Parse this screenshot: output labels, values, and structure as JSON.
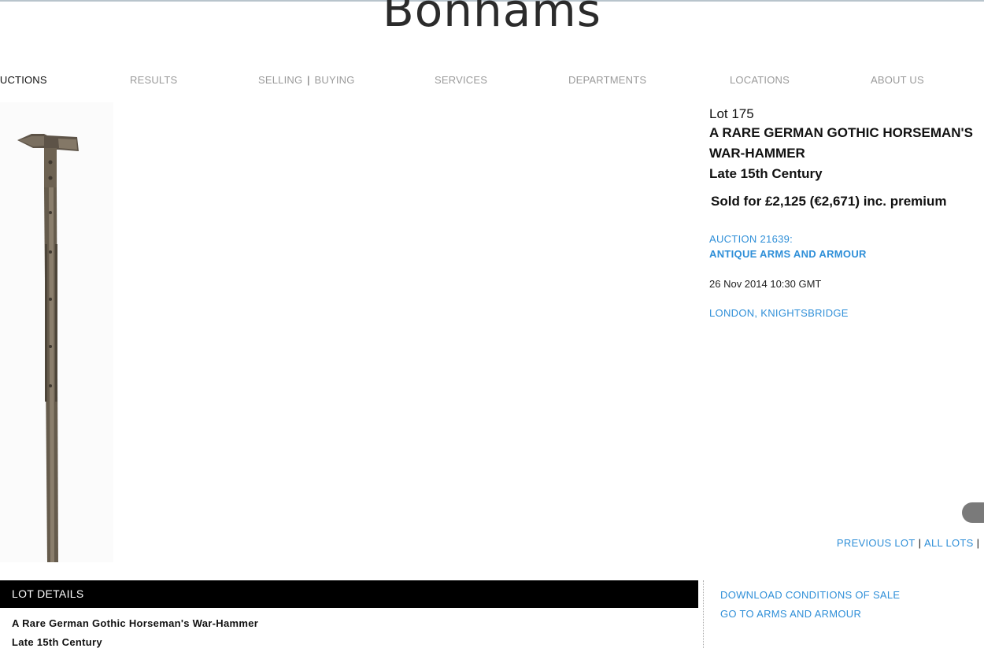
{
  "site": {
    "logo": "Bonhams"
  },
  "nav": {
    "auctions": "AUCTIONS",
    "results": "RESULTS",
    "selling": "SELLING",
    "separator": "|",
    "buying": "BUYING",
    "services": "SERVICES",
    "departments": "DEPARTMENTS",
    "locations": "LOCATIONS",
    "about": "ABOUT US"
  },
  "lot": {
    "number": "Lot 175",
    "title_line1": "A RARE GERMAN GOTHIC HORSEMAN'S",
    "title_line2": "WAR-HAMMER",
    "title_line3": "Late 15th Century",
    "sold": "Sold for £2,125 (€2,671) inc. premium",
    "auction_code": "AUCTION 21639:",
    "auction_name": "ANTIQUE ARMS AND ARMOUR",
    "date": "26 Nov 2014 10:30 GMT",
    "location": "LONDON, KNIGHTSBRIDGE"
  },
  "lot_nav": {
    "previous": "PREVIOUS LOT",
    "separator": "|",
    "all": "ALL LOTS"
  },
  "details": {
    "header": "LOT DETAILS",
    "line1": "A Rare German Gothic Horseman's War-Hammer",
    "line2": "Late 15th Century"
  },
  "side_links": {
    "download": "DOWNLOAD CONDITIONS OF SALE",
    "goto": "GO TO ARMS AND ARMOUR"
  },
  "colors": {
    "link": "#2f8fd8",
    "nav": "#9a9a9a",
    "details_bar": "#000000"
  },
  "icons": {
    "lot_image": "war-hammer-photo"
  }
}
